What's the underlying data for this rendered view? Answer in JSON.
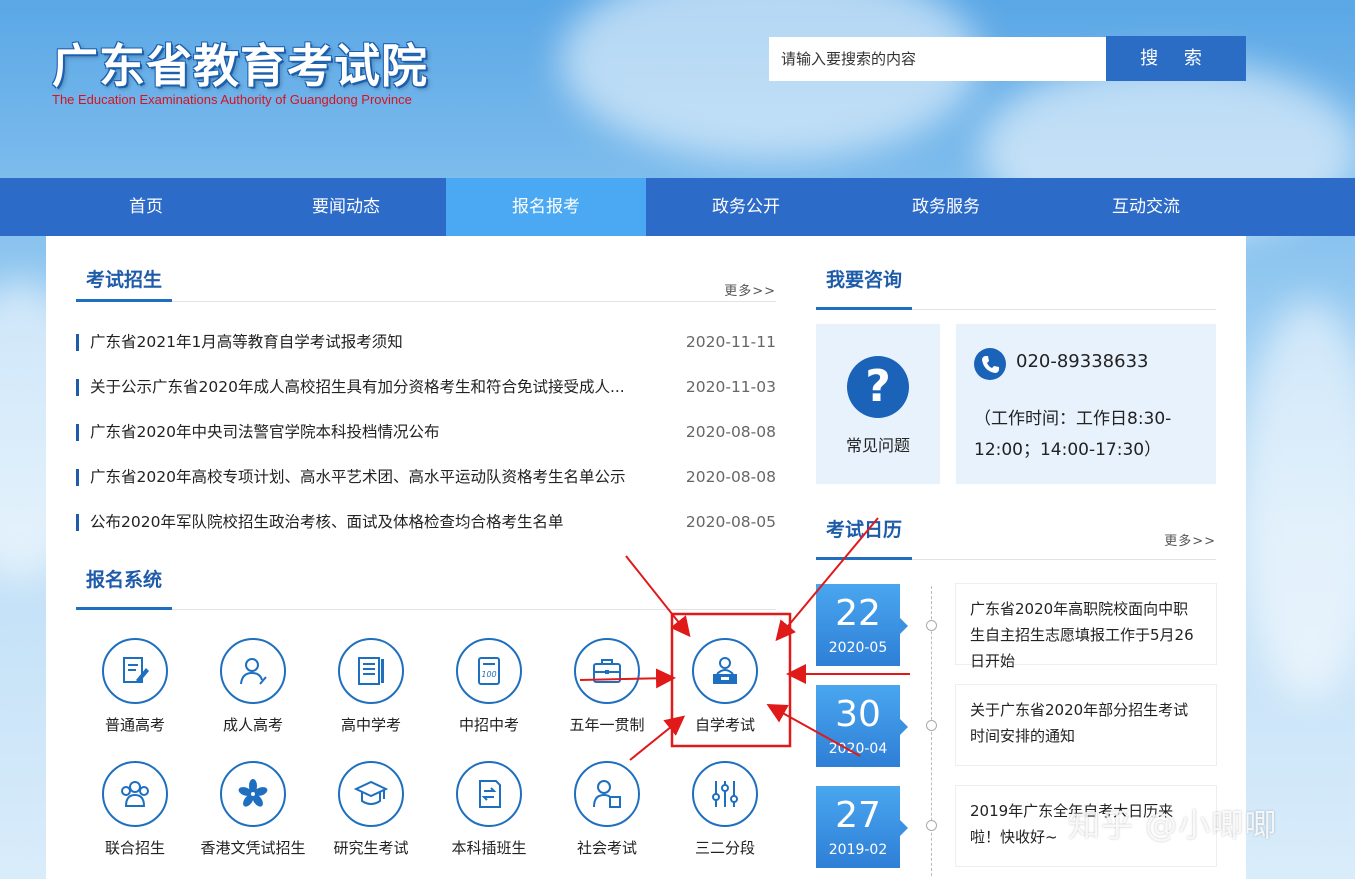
{
  "header": {
    "title": "广东省教育考试院",
    "subtitle": "The Education Examinations Authority of Guangdong Province",
    "search_placeholder": "请输入要搜索的内容",
    "search_button": "搜 索"
  },
  "nav": {
    "items": [
      "首页",
      "要闻动态",
      "报名报考",
      "政务公开",
      "政务服务",
      "互动交流"
    ],
    "active": "报名报考"
  },
  "exam_admission": {
    "title": "考试招生",
    "more": "更多>>",
    "news": [
      {
        "title": "广东省2021年1月高等教育自学考试报考须知",
        "date": "2020-11-11"
      },
      {
        "title": "关于公示广东省2020年成人高校招生具有加分资格考生和符合免试接受成人...",
        "date": "2020-11-03"
      },
      {
        "title": "广东省2020年中央司法警官学院本科投档情况公布",
        "date": "2020-08-08"
      },
      {
        "title": "广东省2020年高校专项计划、高水平艺术团、高水平运动队资格考生名单公示",
        "date": "2020-08-08"
      },
      {
        "title": "公布2020年军队院校招生政治考核、面试及体格检查均合格考生名单",
        "date": "2020-08-05"
      }
    ]
  },
  "registration": {
    "title": "报名系统",
    "systems": [
      {
        "label": "普通高考",
        "icon": "document-pen-icon"
      },
      {
        "label": "成人高考",
        "icon": "person-pen-icon"
      },
      {
        "label": "高中学考",
        "icon": "notebook-icon"
      },
      {
        "label": "中招中考",
        "icon": "certificate-100-icon"
      },
      {
        "label": "五年一贯制",
        "icon": "briefcase-icon"
      },
      {
        "label": "自学考试",
        "icon": "student-desk-icon"
      },
      {
        "label": "联合招生",
        "icon": "group-icon"
      },
      {
        "label": "香港文凭试招生",
        "icon": "bauhinia-icon"
      },
      {
        "label": "研究生考试",
        "icon": "graduation-cap-icon"
      },
      {
        "label": "本科插班生",
        "icon": "transfer-document-icon"
      },
      {
        "label": "社会考试",
        "icon": "person-book-icon"
      },
      {
        "label": "三二分段",
        "icon": "sliders-icon"
      }
    ],
    "highlighted": "自学考试"
  },
  "consult": {
    "title": "我要咨询",
    "faq_label": "常见问题",
    "phone": "020-89338633",
    "hours": "（工作时间：工作日8:30-12:00；14:00-17:30）"
  },
  "calendar": {
    "title": "考试日历",
    "more": "更多>>",
    "events": [
      {
        "day": "22",
        "month": "2020-05",
        "text": "广东省2020年高职院校面向中职生自主招生志愿填报工作于5月26日开始"
      },
      {
        "day": "30",
        "month": "2020-04",
        "text": "关于广东省2020年部分招生考试时间安排的通知"
      },
      {
        "day": "27",
        "month": "2019-02",
        "text": "2019年广东全年自考大日历来啦！快收好~"
      }
    ]
  },
  "watermark": "知乎 @小唧唧",
  "colors": {
    "brand_blue": "#2d6bc9",
    "nav_active": "#4aa9f2",
    "title_blue": "#1e5ba8",
    "annotation_red": "#e01919",
    "subtitle_red": "#d8121d"
  }
}
